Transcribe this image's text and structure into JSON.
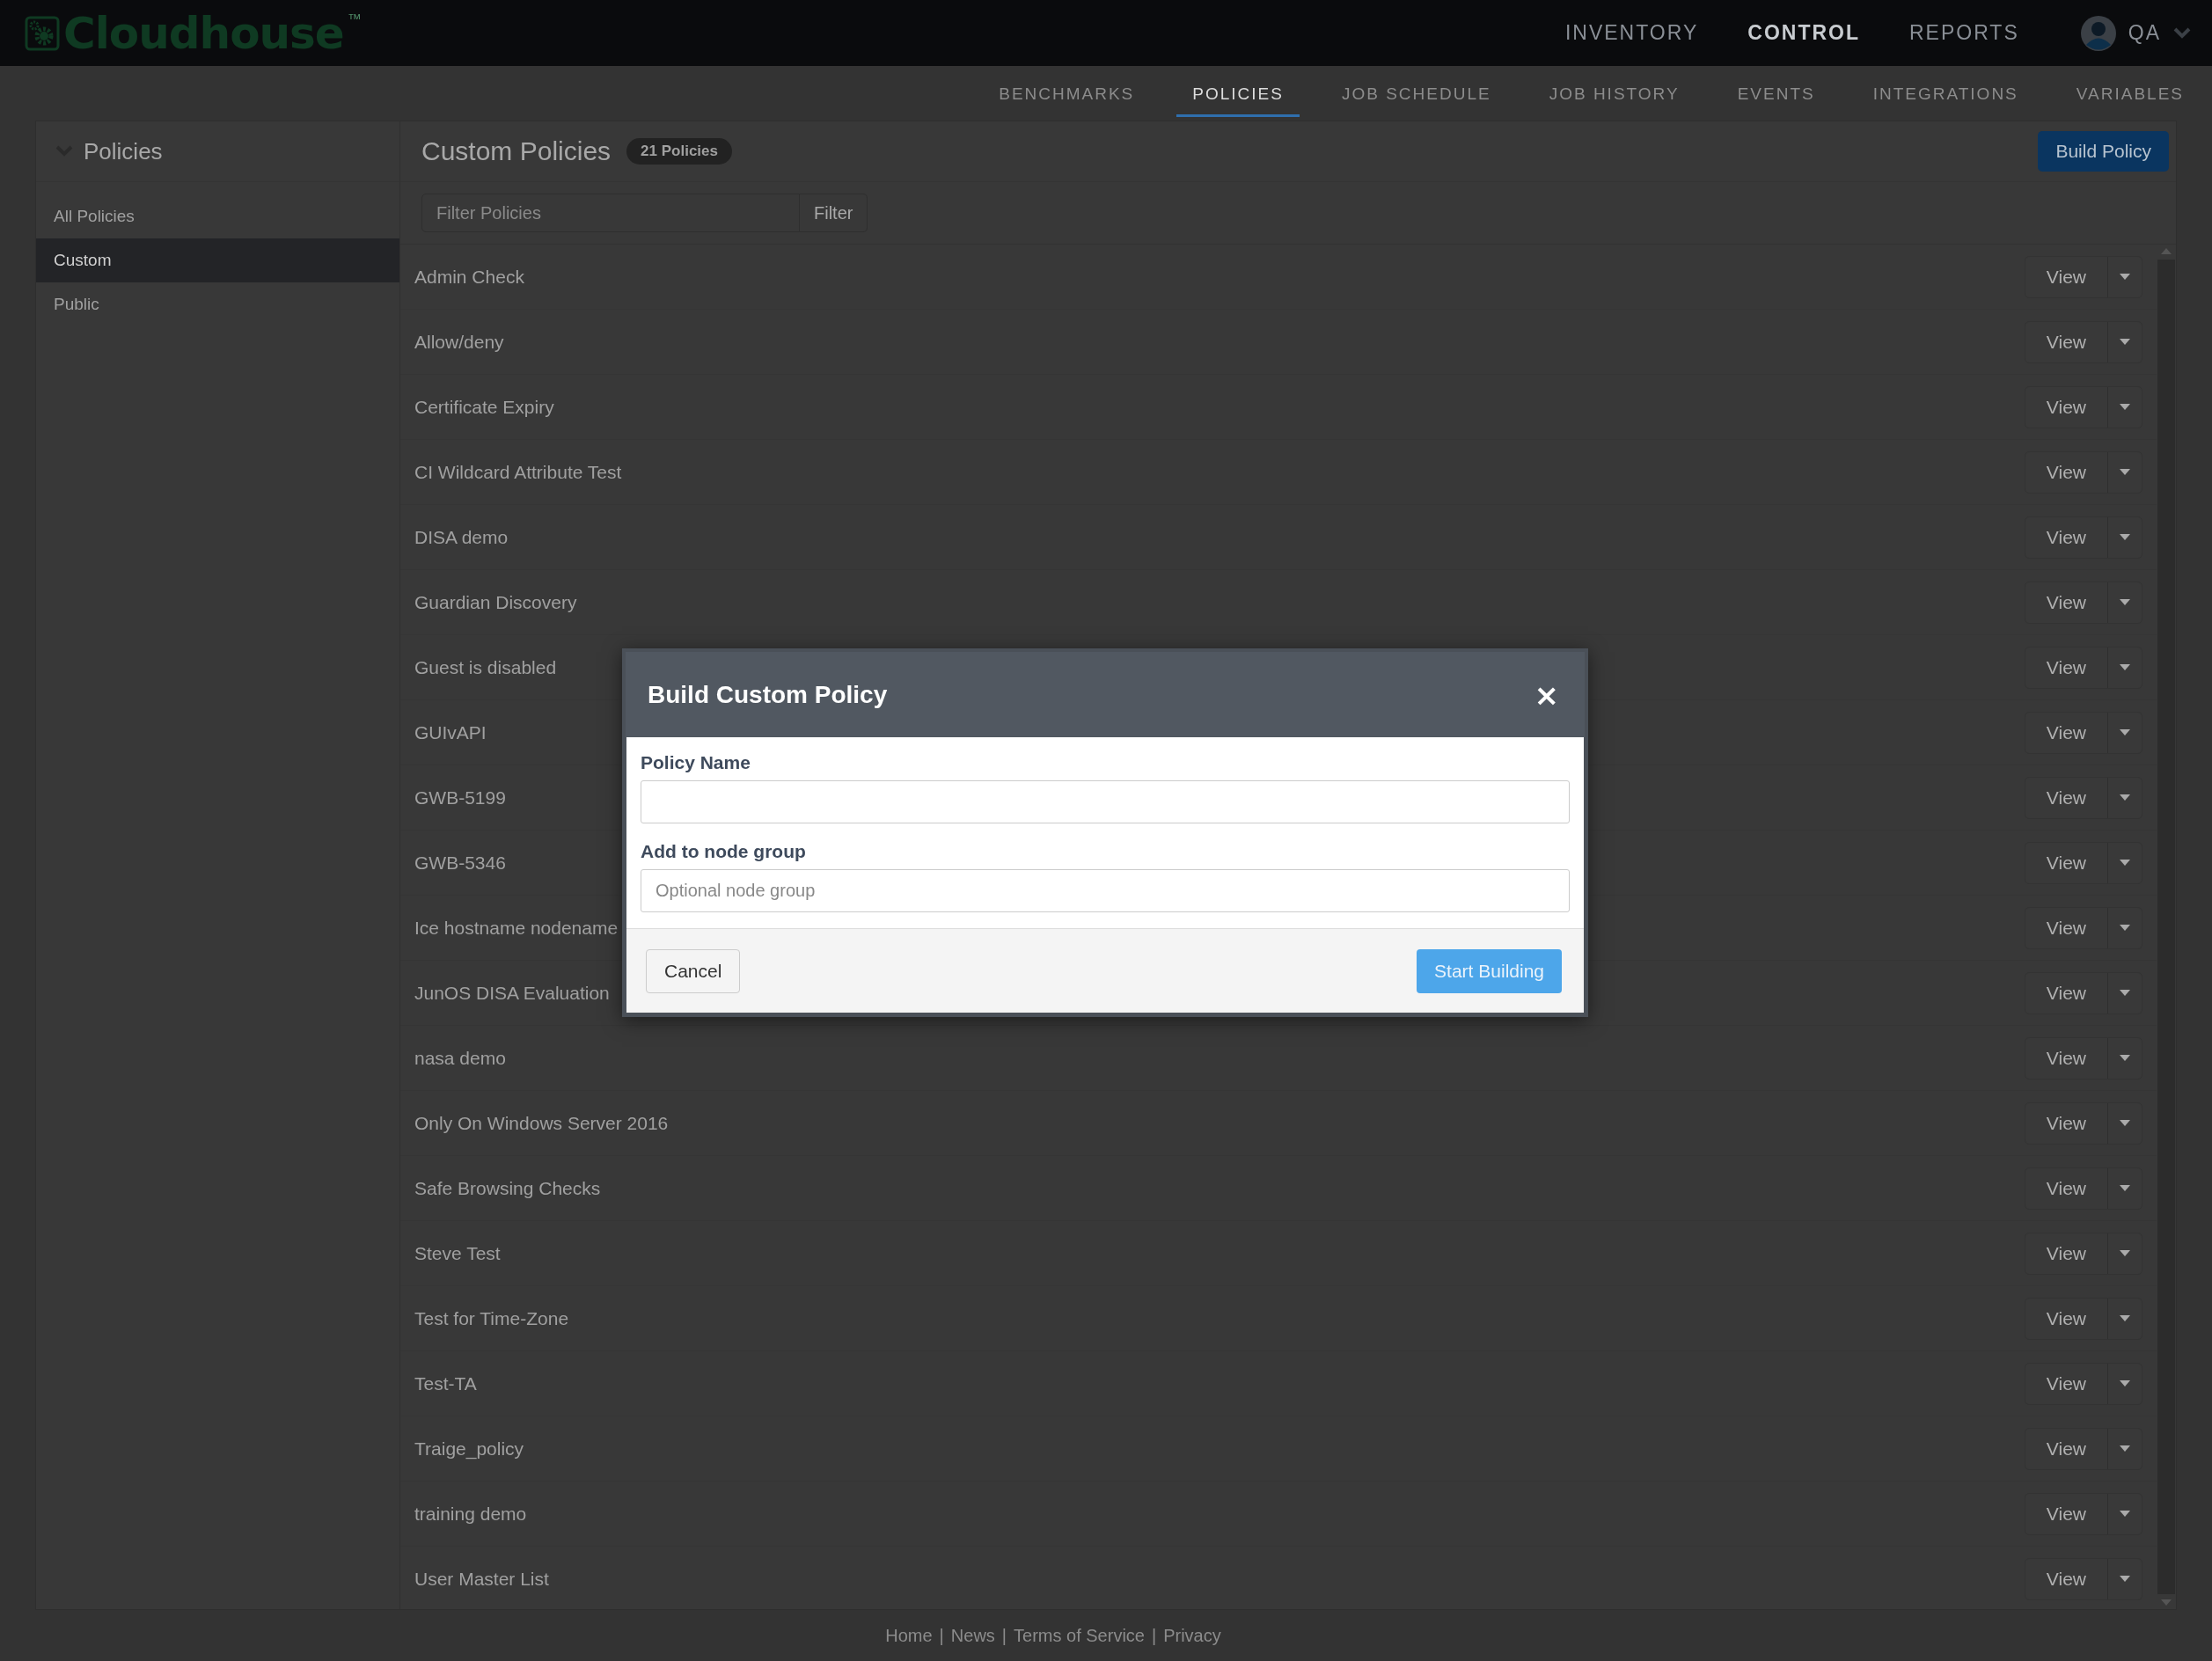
{
  "brand": {
    "name": "Cloudhouse",
    "trademark": "™"
  },
  "nav": [
    {
      "label": "INVENTORY",
      "selected": false
    },
    {
      "label": "CONTROL",
      "selected": true
    },
    {
      "label": "REPORTS",
      "selected": false
    }
  ],
  "user": {
    "name": "QA"
  },
  "subnav": [
    {
      "label": "BENCHMARKS",
      "selected": false
    },
    {
      "label": "POLICIES",
      "selected": true
    },
    {
      "label": "JOB SCHEDULE",
      "selected": false
    },
    {
      "label": "JOB HISTORY",
      "selected": false
    },
    {
      "label": "EVENTS",
      "selected": false
    },
    {
      "label": "INTEGRATIONS",
      "selected": false
    },
    {
      "label": "VARIABLES",
      "selected": false
    }
  ],
  "sidebar": {
    "title": "Policies",
    "items": [
      {
        "label": "All Policies",
        "selected": false
      },
      {
        "label": "Custom",
        "selected": true
      },
      {
        "label": "Public",
        "selected": false
      }
    ]
  },
  "main": {
    "title": "Custom Policies",
    "count_badge": "21 Policies",
    "build_button": "Build Policy",
    "filter": {
      "placeholder": "Filter Policies",
      "button": "Filter"
    },
    "rows": [
      {
        "name": "Admin Check",
        "action": "View"
      },
      {
        "name": "Allow/deny",
        "action": "View"
      },
      {
        "name": "Certificate Expiry",
        "action": "View"
      },
      {
        "name": "CI Wildcard Attribute Test",
        "action": "View"
      },
      {
        "name": "DISA demo",
        "action": "View"
      },
      {
        "name": "Guardian Discovery",
        "action": "View"
      },
      {
        "name": "Guest is disabled",
        "action": "View"
      },
      {
        "name": "GUIvAPI",
        "action": "View"
      },
      {
        "name": "GWB-5199",
        "action": "View"
      },
      {
        "name": "GWB-5346",
        "action": "View"
      },
      {
        "name": "Ice hostname nodename",
        "action": "View"
      },
      {
        "name": "JunOS DISA Evaluation",
        "action": "View"
      },
      {
        "name": "nasa demo",
        "action": "View"
      },
      {
        "name": "Only On Windows Server 2016",
        "action": "View"
      },
      {
        "name": "Safe Browsing Checks",
        "action": "View"
      },
      {
        "name": "Steve Test",
        "action": "View"
      },
      {
        "name": "Test for Time-Zone",
        "action": "View"
      },
      {
        "name": "Test-TA",
        "action": "View"
      },
      {
        "name": "Traige_policy",
        "action": "View"
      },
      {
        "name": "training demo",
        "action": "View"
      },
      {
        "name": "User Master List",
        "action": "View"
      }
    ]
  },
  "modal": {
    "title": "Build Custom Policy",
    "close": "×",
    "fields": [
      {
        "label": "Policy Name"
      },
      {
        "label": "Add to node group",
        "placeholder": "Optional node group"
      }
    ],
    "cancel": "Cancel",
    "submit": "Start Building"
  },
  "footer": {
    "links": [
      "Home",
      "News",
      "Terms of Service",
      "Privacy"
    ],
    "separator": "|"
  }
}
